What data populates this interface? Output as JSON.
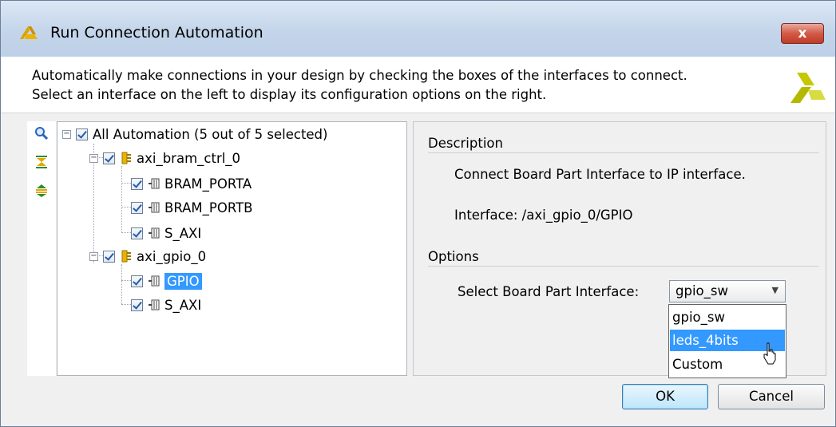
{
  "window": {
    "title": "Run Connection Automation",
    "close_label": "x"
  },
  "header": {
    "line1": "Automatically make connections in your design by checking the boxes of the interfaces to connect.",
    "line2": "Select an interface on the left to display its configuration options on the right."
  },
  "toolbar": {
    "icons": [
      "search-icon",
      "collapse-all-icon",
      "expand-all-icon"
    ]
  },
  "tree": {
    "root": {
      "label": "All Automation (5 out of 5 selected)",
      "checked": true
    },
    "groups": [
      {
        "label": "axi_bram_ctrl_0",
        "checked": true,
        "children": [
          {
            "label": "BRAM_PORTA",
            "checked": true
          },
          {
            "label": "BRAM_PORTB",
            "checked": true
          },
          {
            "label": "S_AXI",
            "checked": true
          }
        ]
      },
      {
        "label": "axi_gpio_0",
        "checked": true,
        "children": [
          {
            "label": "GPIO",
            "checked": true,
            "selected": true
          },
          {
            "label": "S_AXI",
            "checked": true
          }
        ]
      }
    ]
  },
  "details": {
    "description_title": "Description",
    "description_text": "Connect Board Part Interface to IP interface.",
    "interface_text": "Interface: /axi_gpio_0/GPIO",
    "options_title": "Options",
    "select_label": "Select Board Part Interface:",
    "select_value": "gpio_sw",
    "options": [
      "gpio_sw",
      "leds_4bits",
      "Custom"
    ],
    "highlighted_option": "leds_4bits"
  },
  "buttons": {
    "ok": "OK",
    "cancel": "Cancel"
  },
  "colors": {
    "selection": "#3399ff",
    "titlebar": "#c4d5ea",
    "logo": "#c8c800"
  }
}
